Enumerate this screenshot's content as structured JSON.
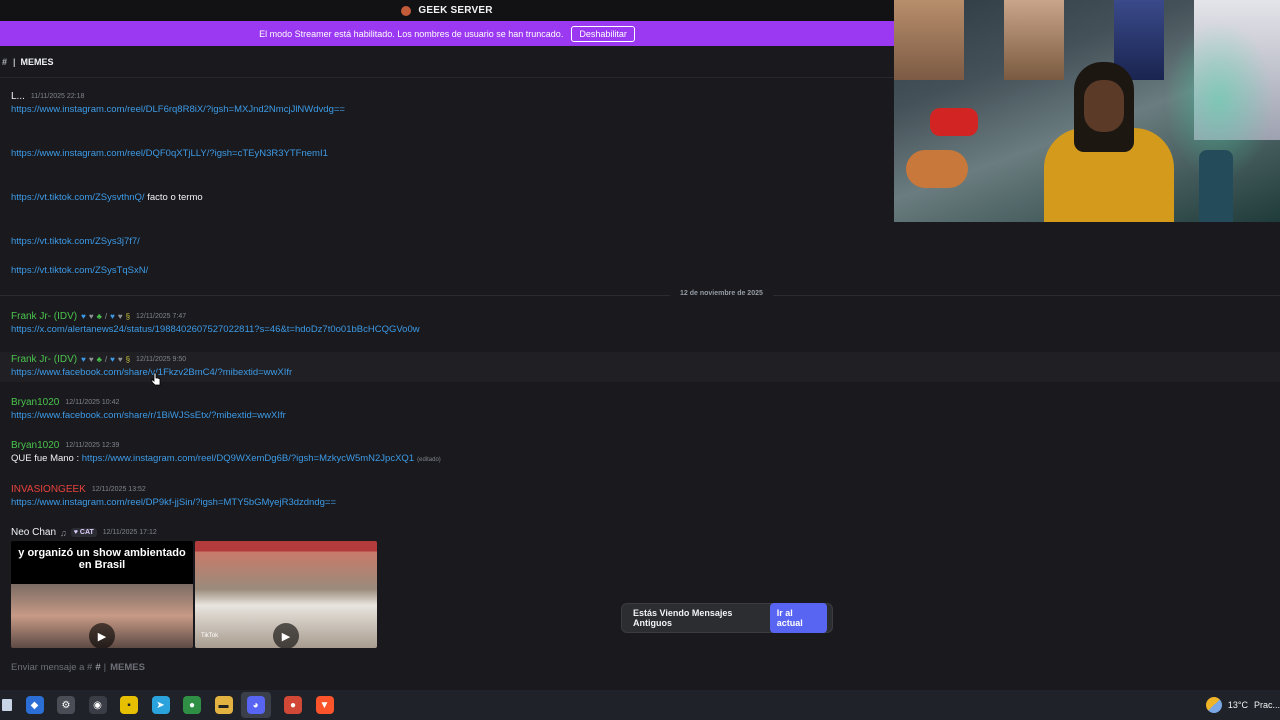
{
  "topbar": {
    "server_name": "GEEK SERVER"
  },
  "streamer_bar": {
    "message": "El modo Streamer está habilitado. Los nombres de usuario se han truncado.",
    "button": "Deshabilitar"
  },
  "channel": {
    "name": "MEMES"
  },
  "messages": [
    {
      "author": "L...",
      "time": "11/11/2025 22:18",
      "lines": [
        {
          "link": "https://www.instagram.com/reel/DLF6rq8R8iX/?igsh=MXJnd2NmcjJlNWdvdg=="
        },
        {
          "link": "https://www.instagram.com/reel/DQF0qXTjLLY/?igsh=cTEyN3R3YTFnemI1"
        },
        {
          "link": "https://vt.tiktok.com/ZSysvthnQ/",
          "text": "facto o termo"
        },
        {
          "link": "https://vt.tiktok.com/ZSys3j7f7/"
        },
        {
          "link": "https://vt.tiktok.com/ZSysTqSxN/"
        }
      ]
    },
    {
      "date_divider": "12 de noviembre de 2025"
    },
    {
      "author": "Frank Jr- (IDV)",
      "time": "12/11/2025 7:47",
      "link": "https://x.com/alertanews24/status/1988402607527022811?s=46&t=hdoDz7t0o01bBcHCQGVo0w"
    },
    {
      "author": "Frank Jr- (IDV)",
      "time": "12/11/2025 9:50",
      "link": "https://www.facebook.com/share/v/1Fkzv2BmC4/?mibextid=wwXIfr"
    },
    {
      "author": "Bryan1020",
      "time": "12/11/2025 10:42",
      "link": "https://www.facebook.com/share/r/1BiWJSsEtx/?mibextid=wwXIfr"
    },
    {
      "author": "Bryan1020",
      "time": "12/11/2025 12:39",
      "prefix": "QUE fue Mano :",
      "link": "https://www.instagram.com/reel/DQ9WXemDg6B/?igsh=MzkycW5mN2JpcXQ1",
      "edited": "(editado)"
    },
    {
      "author": "INVASIONGEEK",
      "time": "12/11/2025 13:52",
      "link": "https://www.instagram.com/reel/DP9kf-jjSin/?igsh=MTY5bGMyejR3dzdndg=="
    },
    {
      "author": "Neo Chan",
      "tag": "CAT",
      "time": "12/11/2025 17:12",
      "video_caption": "y organizó un show ambientado en Brasil",
      "video_badge": "TikTok"
    }
  ],
  "toast": {
    "text": "Estás Viendo Mensajes Antiguos",
    "button": "Ir al actual"
  },
  "composer": {
    "placeholder": "Enviar mensaje a #",
    "channel": "MEMES"
  },
  "tray": {
    "temp": "13°C",
    "weather_text": "Prac..."
  },
  "colors": {
    "accent": "#5865f2",
    "streamer": "#9b38f2",
    "link": "#3d9ae6",
    "green_name": "#4ac34d",
    "red_name": "#e8423c"
  }
}
